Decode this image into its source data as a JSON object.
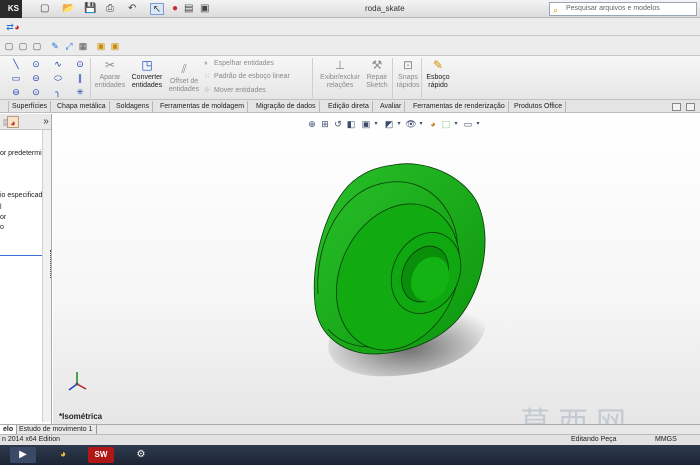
{
  "app": {
    "logo_text": "KS",
    "document_title": "roda_skate"
  },
  "search": {
    "placeholder": "Pesquisar arquivos e modelos"
  },
  "ribbon": {
    "aparar": "Aparar entidades",
    "converter": "Converter entidades",
    "offset": "Offset de entidades",
    "espelhar": "Espelhar entidades",
    "padrao": "Padrão de esboço linear",
    "mover": "Mover entidades",
    "exibir": "Exibir/excluir relações",
    "repair": "Repair Sketch",
    "snaps": "Snaps rápidos",
    "esboco": "Esboço rápido"
  },
  "tabs": [
    "Superfícies",
    "Chapa metálica",
    "Soldagens",
    "Ferramentas de moldagem",
    "Migração de dados",
    "Edição direta",
    "Avaliar",
    "Ferramentas de renderização",
    "Produtos Office"
  ],
  "left_panel": {
    "line1": "or predetermina",
    "line2": "io especificado>",
    "line3": "l",
    "line4": "or",
    "line5": "o",
    "tab_more": "»"
  },
  "viewport": {
    "view_label": "*Isométrica"
  },
  "bottom_tabs": [
    "elo",
    "Estudo de movimento 1"
  ],
  "status": {
    "edition": "n 2014 x64 Edition",
    "mode": "Editando Peça",
    "units": "MMGS"
  },
  "watermark": "莫西网",
  "colors": {
    "part_green": "#12b012",
    "ribbon_active": "#1b4fc9",
    "taskbar": "#1b2433"
  }
}
